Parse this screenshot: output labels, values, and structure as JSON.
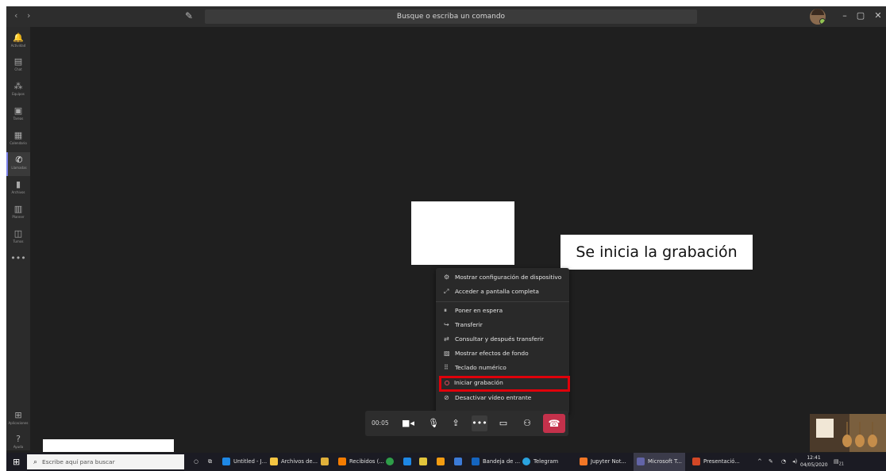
{
  "titlebar": {
    "back": "‹",
    "forward": "›",
    "compose_icon": "edit-icon",
    "search_placeholder": "Busque o escriba un comando",
    "minimize": "–",
    "maximize": "▢",
    "close": "✕"
  },
  "rail": {
    "items": [
      {
        "label": "Actividad",
        "icon": "🔔"
      },
      {
        "label": "Chat",
        "icon": "▤"
      },
      {
        "label": "Equipos",
        "icon": "⁂"
      },
      {
        "label": "Tareas",
        "icon": "▣"
      },
      {
        "label": "Calendario",
        "icon": "▦"
      },
      {
        "label": "Llamadas",
        "icon": "✆"
      },
      {
        "label": "Archivos",
        "icon": "▮"
      },
      {
        "label": "Planner",
        "icon": "▥"
      },
      {
        "label": "Turnos",
        "icon": "◫"
      },
      {
        "label": "",
        "icon": "•••"
      }
    ],
    "apps_label": "Aplicaciones",
    "apps_icon": "⊞",
    "help_label": "Ayuda",
    "help_icon": "?"
  },
  "stage": {
    "caption": "Se inicia la grabación"
  },
  "menu": {
    "group1": [
      {
        "icon": "⚙",
        "label": "Mostrar configuración de dispositivo"
      },
      {
        "icon": "⤢",
        "label": "Acceder a pantalla completa"
      }
    ],
    "group2": [
      {
        "icon": "⏸",
        "label": "Poner en espera"
      },
      {
        "icon": "↪",
        "label": "Transferir"
      },
      {
        "icon": "⇄",
        "label": "Consultar y después transferir"
      },
      {
        "icon": "▨",
        "label": "Mostrar efectos de fondo"
      },
      {
        "icon": "⠿",
        "label": "Teclado numérico"
      },
      {
        "icon": "",
        "label": "Iniciar grabación"
      },
      {
        "icon": "⊘",
        "label": "Desactivar vídeo entrante"
      }
    ]
  },
  "callbar": {
    "timer": "00:05",
    "camera": "■◂",
    "mic": "🎙",
    "share": "⇪",
    "more": "•••",
    "chat": "▭",
    "participants": "⚇",
    "hangup": "☎"
  },
  "taskbar": {
    "search_placeholder": "Escribe aquí para buscar",
    "items": [
      {
        "label": "Untitled - J...",
        "color": "#1e88e5"
      },
      {
        "label": "Archivos de...",
        "color": "#f4c542"
      },
      {
        "label": "Recibidos (...",
        "color": "#f57c00"
      },
      {
        "label": "Bandeja de ...",
        "color": "#1565c0"
      },
      {
        "label": "Telegram",
        "color": "#2aa3df"
      },
      {
        "label": "Jupyter Not...",
        "color": "#f37726"
      },
      {
        "label": "Microsoft T...",
        "color": "#6264a7"
      },
      {
        "label": "Presentació...",
        "color": "#d24726"
      }
    ],
    "clock_time": "12:41",
    "clock_date": "04/05/2020",
    "notifications_badge": "21"
  }
}
